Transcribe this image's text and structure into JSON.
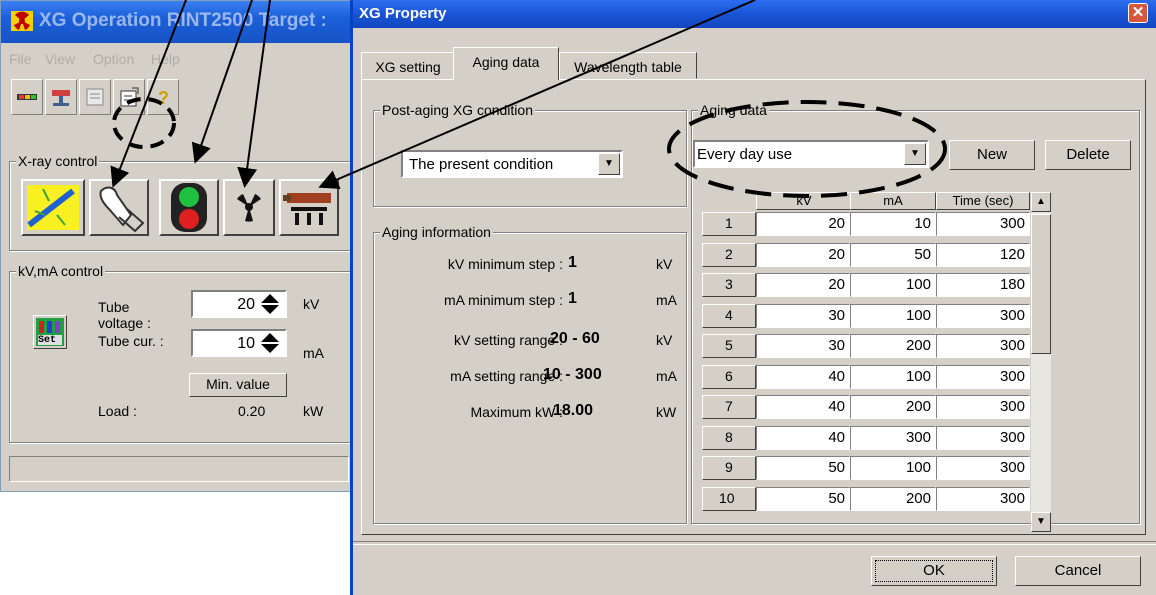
{
  "main_window": {
    "title": "XG Operation RINT2500  Target : ",
    "menu": [
      "File",
      "View",
      "Option",
      "Help"
    ],
    "toolbar_icons": [
      "status-lamp-icon",
      "network-icon",
      "list-icon",
      "property-icon",
      "help-icon"
    ],
    "xray_control": {
      "label": "X-ray control",
      "buttons": [
        "sample-aging-icon",
        "hand-cleaning-icon",
        "traffic-light-icon",
        "radiation-icon",
        "xray-tube-icon"
      ]
    },
    "kvma_control": {
      "label": "kV,mA control",
      "set_label": "Set",
      "tube_voltage_label": "Tube\nvoltage :",
      "tube_voltage_value": "20",
      "tube_voltage_unit": "kV",
      "tube_current_label": "Tube cur. :",
      "tube_current_value": "10",
      "tube_current_unit": "mA",
      "min_value_button": "Min. value",
      "load_label": "Load :",
      "load_value": "0.20",
      "load_unit": "kW"
    }
  },
  "dialog": {
    "title": "XG Property",
    "close_glyph": "✕",
    "tabs": [
      "XG setting",
      "Aging data",
      "Wavelength table"
    ],
    "active_tab": 1,
    "post_aging": {
      "label": "Post-aging XG condition",
      "selected": "The present condition"
    },
    "aging_info": {
      "label": "Aging information",
      "rows": [
        {
          "key": "kV minimum step :",
          "value": "1",
          "unit": "kV"
        },
        {
          "key": "mA minimum step :",
          "value": "1",
          "unit": "mA"
        },
        {
          "key": "kV setting range :",
          "value": "20 - 60",
          "unit": "kV"
        },
        {
          "key": "mA setting range :",
          "value": "10 - 300",
          "unit": "mA"
        },
        {
          "key": "Maximum kW :",
          "value": "18.00",
          "unit": "kW"
        }
      ]
    },
    "aging_data": {
      "label": "Aging data",
      "selected": "Every day use",
      "new_button": "New",
      "delete_button": "Delete",
      "columns": [
        "kV",
        "mA",
        "Time (sec)"
      ],
      "rows": [
        [
          "1",
          "20",
          "10",
          "300"
        ],
        [
          "2",
          "20",
          "50",
          "120"
        ],
        [
          "3",
          "20",
          "100",
          "180"
        ],
        [
          "4",
          "30",
          "100",
          "300"
        ],
        [
          "5",
          "30",
          "200",
          "300"
        ],
        [
          "6",
          "40",
          "100",
          "300"
        ],
        [
          "7",
          "40",
          "200",
          "300"
        ],
        [
          "8",
          "40",
          "300",
          "300"
        ],
        [
          "9",
          "50",
          "100",
          "300"
        ],
        [
          "10",
          "50",
          "200",
          "300"
        ]
      ]
    },
    "ok_button": "OK",
    "cancel_button": "Cancel"
  },
  "colors": {
    "window_bg": "#d4d0c8",
    "titlebar_blue": "#1c5fd8",
    "annotation": "#000000"
  }
}
